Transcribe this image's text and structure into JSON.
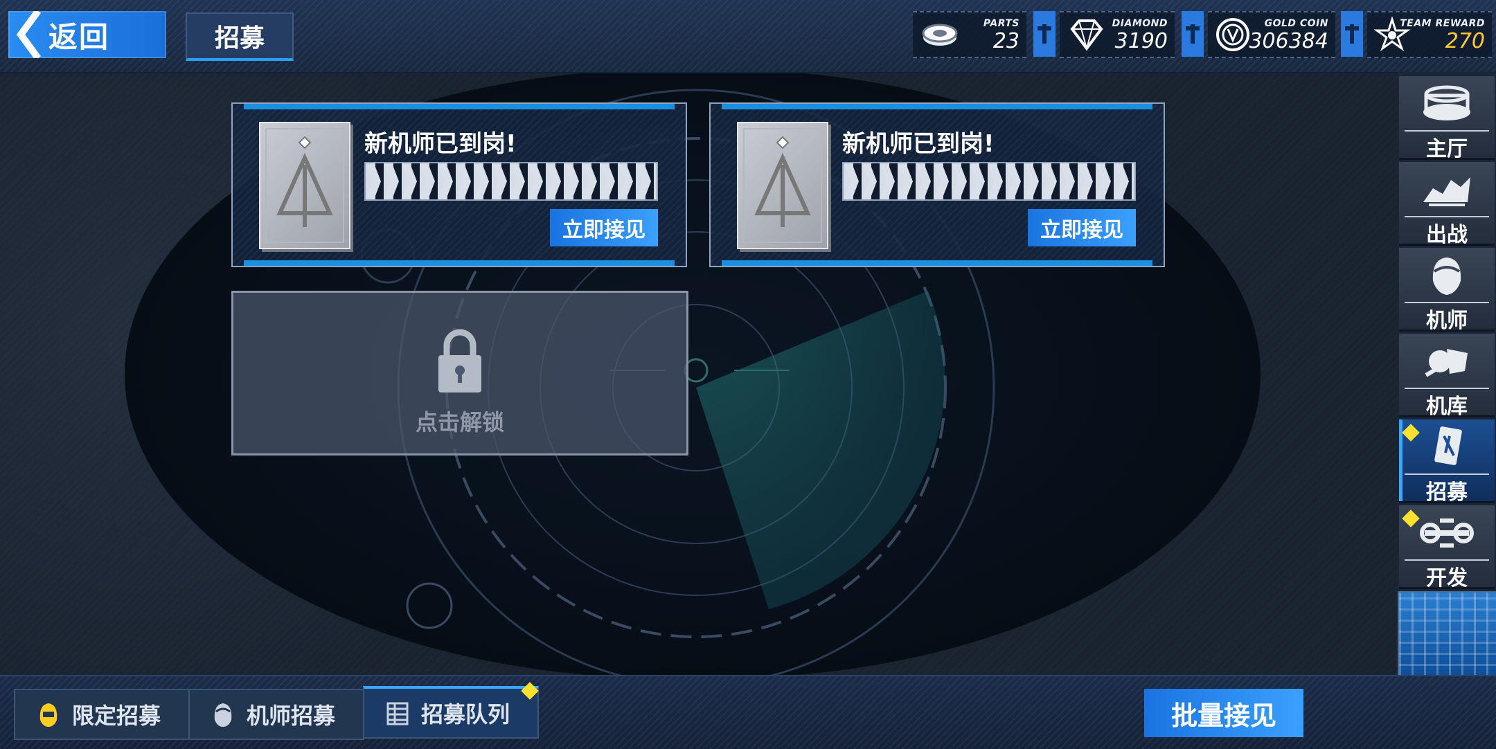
{
  "header": {
    "back_label": "返回",
    "page_title": "招募"
  },
  "resources": [
    {
      "name": "PARTS",
      "value": "23",
      "icon": "parts-icon"
    },
    {
      "name": "DIAMOND",
      "value": "3190",
      "icon": "diamond-icon"
    },
    {
      "name": "GOLD COIN",
      "value": "306384",
      "icon": "gold-coin-icon"
    },
    {
      "name": "TEAM REWARD",
      "value": "270",
      "icon": "team-reward-icon",
      "color": "#ffcc33"
    }
  ],
  "cards": [
    {
      "title": "新机师已到岗!",
      "button": "立即接见"
    },
    {
      "title": "新机师已到岗!",
      "button": "立即接见"
    }
  ],
  "locked_slot": {
    "label": "点击解锁",
    "icon": "lock-icon"
  },
  "nav": [
    {
      "label": "主厅",
      "icon": "hall-icon",
      "active": false,
      "badge": false
    },
    {
      "label": "出战",
      "icon": "sortie-icon",
      "active": false,
      "badge": false
    },
    {
      "label": "机师",
      "icon": "pilot-icon",
      "active": false,
      "badge": false
    },
    {
      "label": "机库",
      "icon": "hangar-icon",
      "active": false,
      "badge": false
    },
    {
      "label": "招募",
      "icon": "recruit-icon",
      "active": true,
      "badge": true
    },
    {
      "label": "开发",
      "icon": "develop-icon",
      "active": false,
      "badge": true
    }
  ],
  "bottom_tabs": [
    {
      "label": "限定招募",
      "icon": "limited-recruit-icon",
      "active": false
    },
    {
      "label": "机师招募",
      "icon": "pilot-recruit-icon",
      "active": false
    },
    {
      "label": "招募队列",
      "icon": "queue-icon",
      "active": true,
      "badge": true
    }
  ],
  "batch_button": "批量接见",
  "colors": {
    "accent": "#2a8cf0",
    "badge": "#ffe12e",
    "gold": "#ffcc33"
  }
}
